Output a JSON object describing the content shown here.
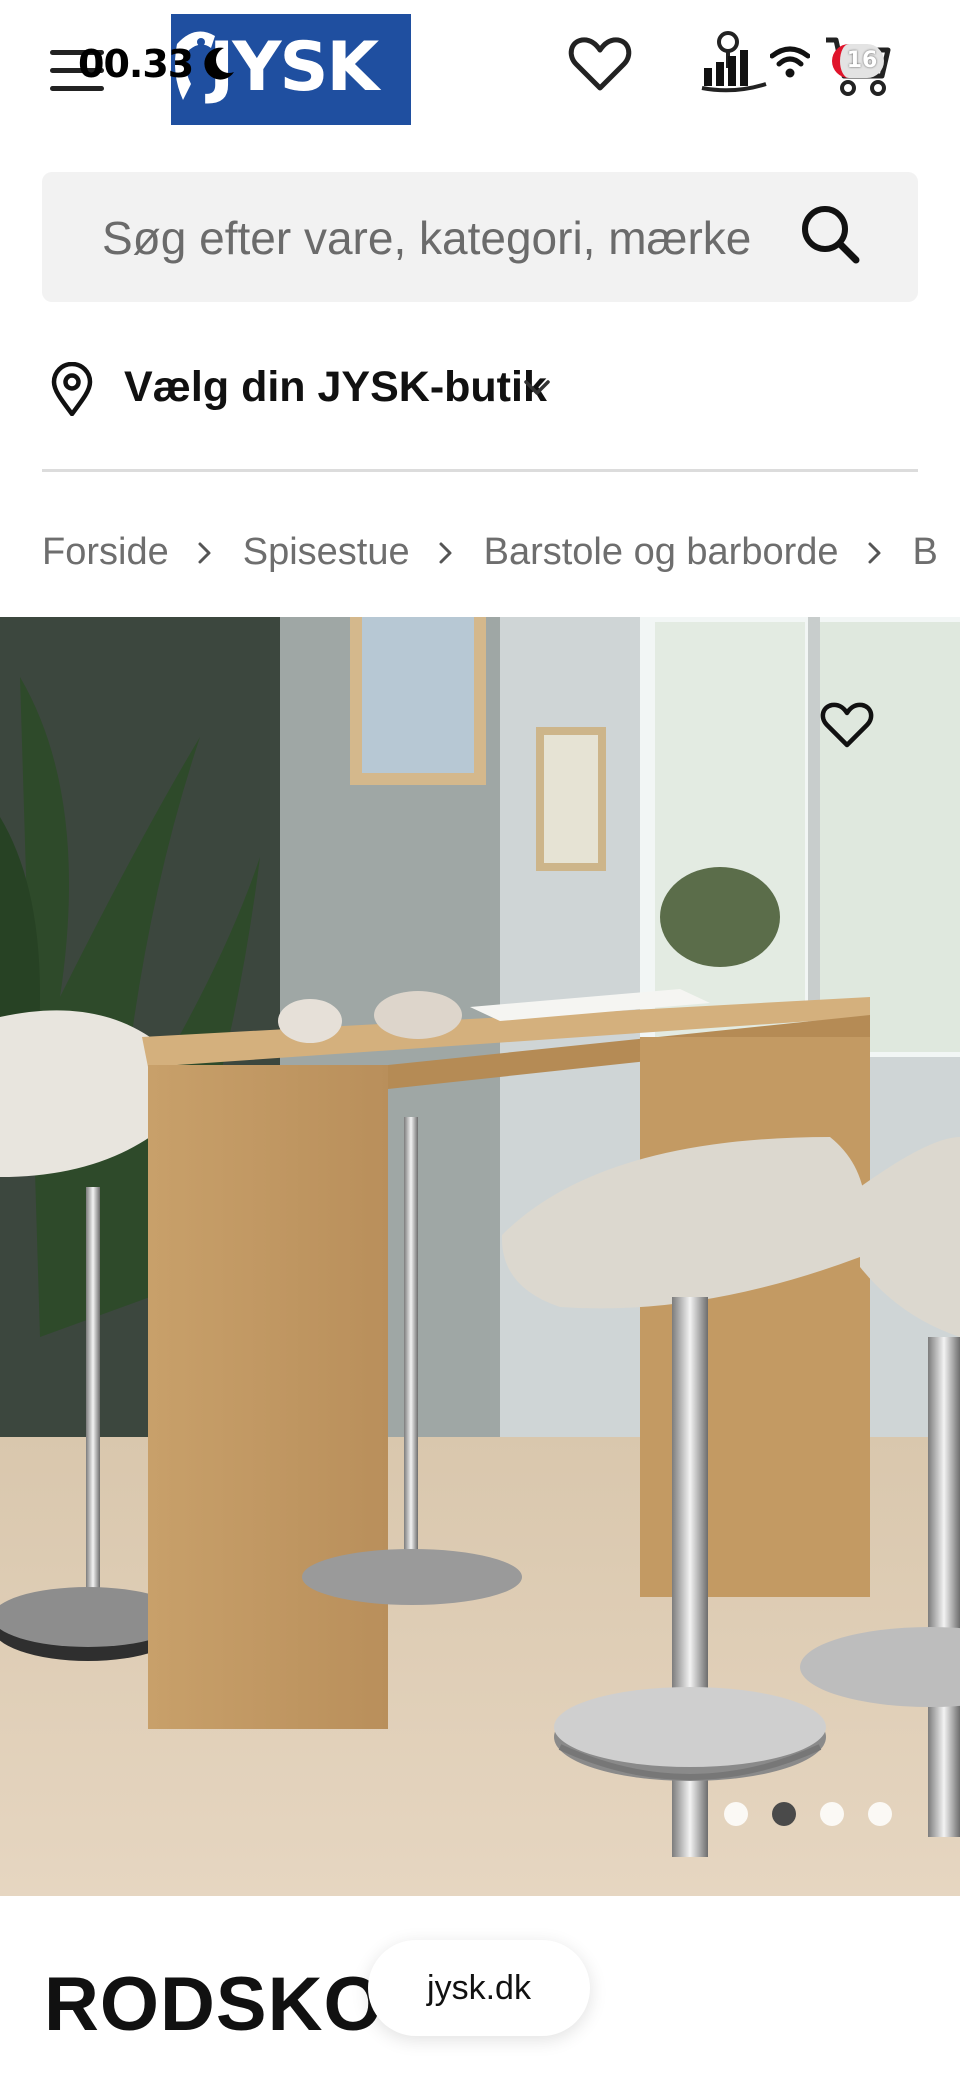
{
  "status_bar": {
    "time": "00.33",
    "badge_count": "16"
  },
  "header": {
    "logo_text": "JYSK",
    "brand_color": "#1f4fa0",
    "icons": [
      "menu-icon",
      "heart-icon",
      "store-icon",
      "wifi-icon",
      "cart-icon"
    ]
  },
  "search": {
    "placeholder": "Søg efter vare, kategori, mærke"
  },
  "store_picker": {
    "label": "Vælg din JYSK-butik"
  },
  "breadcrumb": {
    "items": [
      "Forside",
      "Spisestue",
      "Barstole og barborde",
      "B"
    ]
  },
  "gallery": {
    "slide_count": 4,
    "active_slide": 2
  },
  "product": {
    "title": "RODSKOV"
  },
  "browser": {
    "url": "jysk.dk"
  }
}
